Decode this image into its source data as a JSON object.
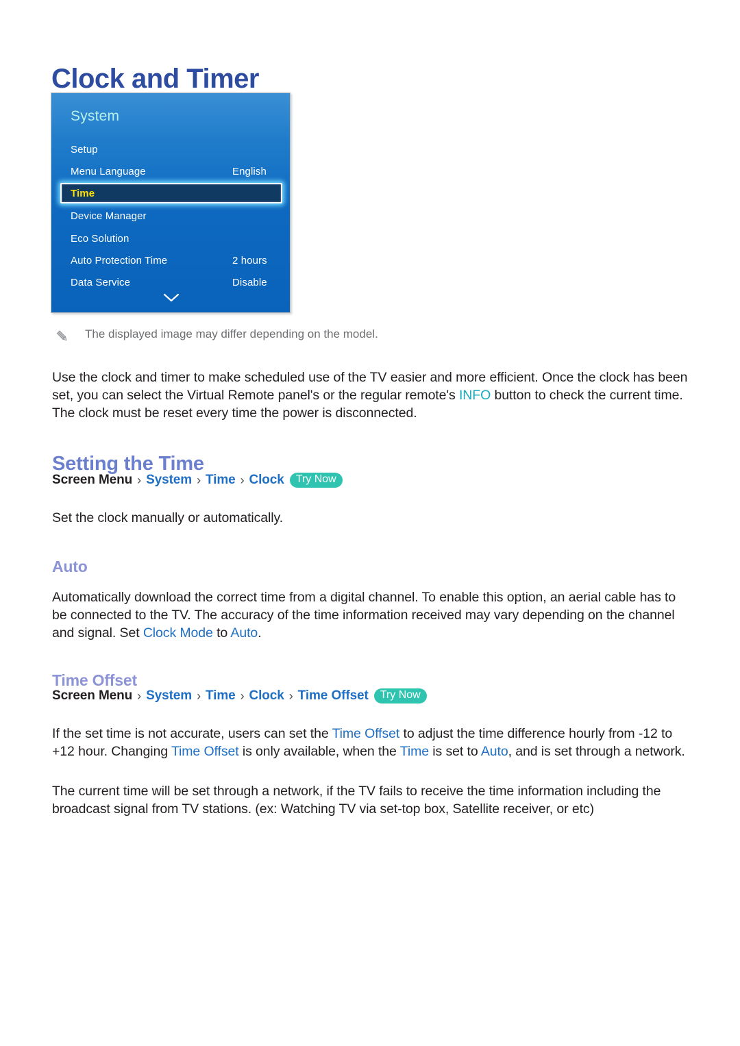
{
  "page": {
    "title": "Clock and Timer"
  },
  "tv_menu": {
    "heading": "System",
    "chevron_icon": "chevron-down-icon",
    "rows": [
      {
        "label": "Setup",
        "value": ""
      },
      {
        "label": "Menu Language",
        "value": "English"
      },
      {
        "label": "Time",
        "value": "",
        "selected": true
      },
      {
        "label": "Device Manager",
        "value": ""
      },
      {
        "label": "Eco Solution",
        "value": ""
      },
      {
        "label": "Auto Protection Time",
        "value": "2 hours"
      },
      {
        "label": "Data Service",
        "value": "Disable"
      }
    ]
  },
  "note": {
    "icon": "pencil-icon",
    "text": "The displayed image may differ depending on the model."
  },
  "intro": {
    "part1": "Use the clock and timer to make scheduled use of the TV easier and more efficient. Once the clock has been set, you can select the Virtual Remote panel's or the regular remote's ",
    "info": "INFO",
    "part2": " button to check the current time. The clock must be reset every time the power is disconnected."
  },
  "setting_the_time": {
    "heading": "Setting the Time",
    "breadcrumb": {
      "root": "Screen Menu",
      "sep": "›",
      "items": [
        "System",
        "Time",
        "Clock"
      ],
      "try_now": "Try Now"
    },
    "description": "Set the clock manually or automatically."
  },
  "auto": {
    "heading": "Auto",
    "part1": "Automatically download the correct time from a digital channel. To enable this option, an aerial cable has to be connected to the TV. The accuracy of the time information received may vary depending on the channel and signal. Set ",
    "link1": "Clock Mode",
    "part2": " to ",
    "link2": "Auto",
    "part3": "."
  },
  "time_offset": {
    "heading": "Time Offset",
    "breadcrumb": {
      "root": "Screen Menu",
      "sep": "›",
      "items": [
        "System",
        "Time",
        "Clock",
        "Time Offset"
      ],
      "try_now": "Try Now"
    },
    "p1": {
      "part1": "If the set time is not accurate, users can set the ",
      "link1": "Time Offset",
      "part2": " to adjust the time difference hourly from -12 to +12 hour. Changing ",
      "link2": "Time Offset",
      "part3": " is only available, when the ",
      "link3": "Time",
      "part4": " is set to ",
      "link4": "Auto",
      "part5": ", and is set through a network."
    },
    "p2": "The current time will be set through a network, if the TV fails to receive the time information including the broadcast signal from TV stations. (ex: Watching TV via set-top box, Satellite receiver, or etc)"
  },
  "colors": {
    "title_blue": "#2f4da0",
    "heading_blue": "#6b7fce",
    "subheading_blue": "#8c93d6",
    "link_blue": "#1f6fc4",
    "info_teal": "#18a9bd",
    "badge_teal": "#2ec4b0",
    "menu_blue": "#0d68bf",
    "menu_selected": "#113a63",
    "menu_selected_text": "#ffe000"
  }
}
